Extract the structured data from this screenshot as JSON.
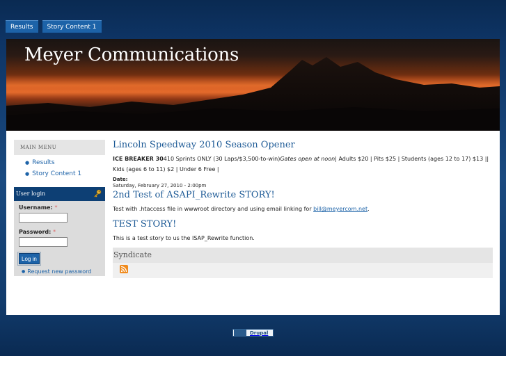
{
  "topnav": {
    "items": [
      {
        "label": "Results"
      },
      {
        "label": "Story Content 1"
      }
    ]
  },
  "header": {
    "site_name": "Meyer Communications"
  },
  "sidebar": {
    "main_menu": {
      "title": "MAIN MENU",
      "items": [
        {
          "label": "Results"
        },
        {
          "label": "Story Content 1"
        }
      ]
    },
    "user_login": {
      "title": "User login",
      "username_label": "Username:",
      "password_label": "Password:",
      "required_marker": "*",
      "login_button": "Log in",
      "request_password": "Request new password"
    }
  },
  "nodes": [
    {
      "title": "Lincoln Speedway 2010 Season Opener",
      "body_bold": "ICE BREAKER 30",
      "body_part1": "410 Sprints ONLY (30 Laps/$3,500-to-win)",
      "body_italic": "Gates open at noon",
      "body_part2": "| Adults $20 | Pits $25 | Students (ages 12 to 17) $13 || Kids (ages 6 to 11) $2 | Under 6 Free |",
      "date_label": "Date:",
      "date_value": "Saturday, February 27, 2010 - 2:00pm"
    },
    {
      "title": "2nd Test of ASAPI_Rewrite STORY!",
      "body_before": "Test with .htaccess file in wwwroot directory and using email linking for ",
      "body_link": "bill@meyercom.net",
      "body_after": "."
    },
    {
      "title": "TEST STORY!",
      "body": "This is a test story to us the ISAP_Rewrite function."
    }
  ],
  "syndicate": {
    "title": "Syndicate",
    "icon": "rss-feed-icon"
  },
  "footer": {
    "badge_label": "Drupal"
  },
  "colors": {
    "link": "#1d63a8",
    "nav_bg": "#1d63a8",
    "login_header": "#0d3f74",
    "page_bg": "#113b6c"
  }
}
